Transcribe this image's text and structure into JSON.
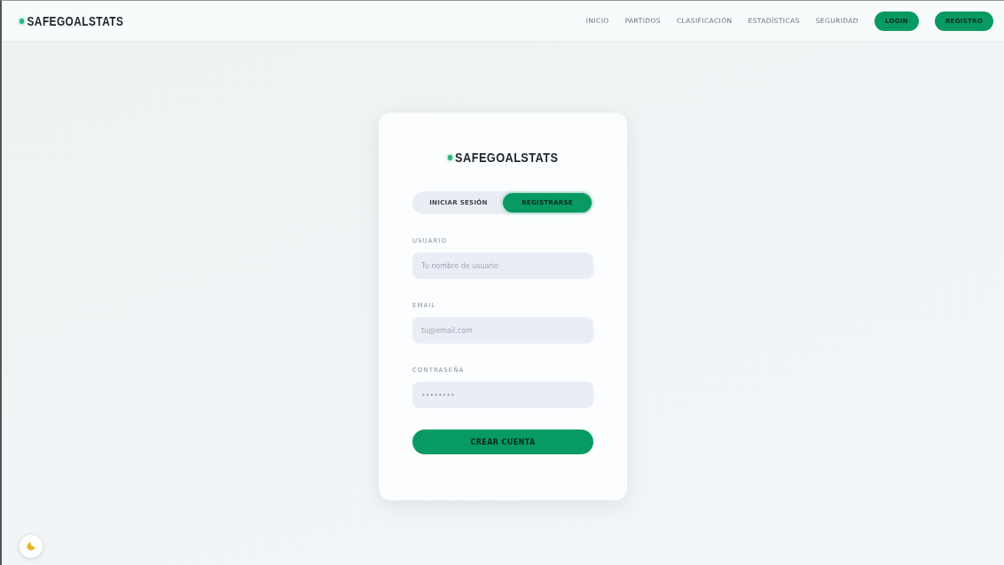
{
  "nav": {
    "logo": "SAFEGOALSTATS",
    "links": [
      {
        "label": "INICIO"
      },
      {
        "label": "PARTIDOS"
      },
      {
        "label": "CLASIFICACIÓN"
      },
      {
        "label": "ESTADÍSTICAS"
      },
      {
        "label": "SEGURIDAD"
      }
    ],
    "buttons": [
      {
        "label": "LOGIN"
      },
      {
        "label": "REGISTRO"
      }
    ]
  },
  "card": {
    "logo": "SAFEGOALSTATS",
    "tabs": [
      {
        "label": "INICIAR SESIÓN",
        "selected": false
      },
      {
        "label": "REGISTRARSE",
        "selected": true
      }
    ],
    "fields": [
      {
        "label": "USUARIO",
        "placeholder": "Tu nombre de usuario"
      },
      {
        "label": "EMAIL",
        "placeholder": "tu@email.com"
      },
      {
        "label": "CONTRASEÑA",
        "placeholder": "••••••••"
      }
    ],
    "submit": "CREAR CUENTA"
  }
}
